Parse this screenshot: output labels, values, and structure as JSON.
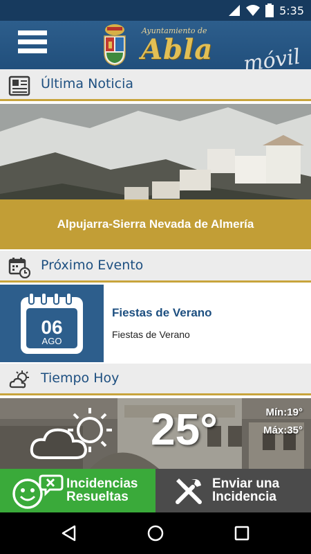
{
  "status": {
    "time": "5:35"
  },
  "header": {
    "brand_small": "Ayuntamiento de",
    "brand_big": "Abla",
    "brand_tag": "móvil"
  },
  "news": {
    "section_title": "Última Noticia",
    "headline": "Alpujarra-Sierra Nevada de Almería"
  },
  "event": {
    "section_title": "Próximo Evento",
    "day": "06",
    "month": "AGO",
    "title": "Fiestas de Verano",
    "description": "Fiestas de Verano"
  },
  "weather": {
    "section_title": "Tiempo Hoy",
    "temperature": "25°",
    "min": "Mín:19°",
    "max": "Máx:35°",
    "icon": "partly-cloudy-icon"
  },
  "actions": {
    "resolved_line1": "Incidencias",
    "resolved_line2": "Resueltas",
    "report_line1": "Enviar una",
    "report_line2": "Incidencia"
  },
  "colors": {
    "brand_blue": "#2d5e8c",
    "gold": "#c8a43c",
    "green": "#3aaa3a",
    "dark_gray": "#4b4b4b"
  }
}
